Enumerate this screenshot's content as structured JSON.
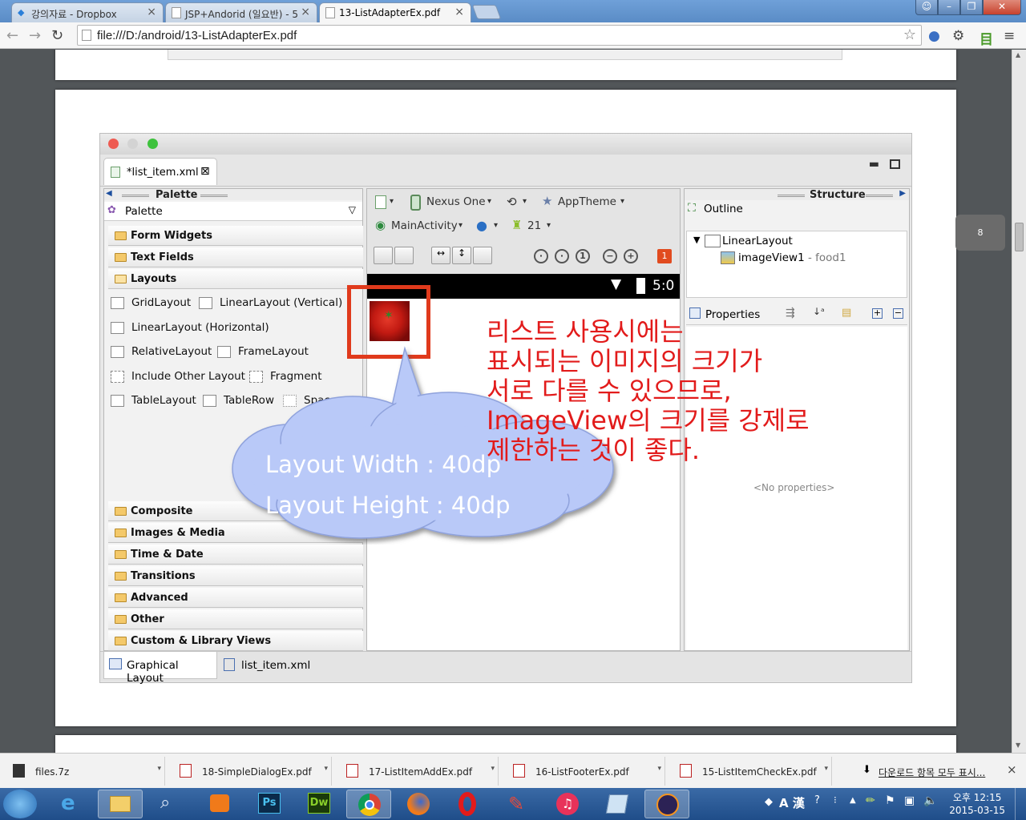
{
  "browser": {
    "tabs": [
      {
        "title": "강의자료 - Dropbox",
        "active": false
      },
      {
        "title": "JSP+Andorid (일요반) - 5",
        "active": false
      },
      {
        "title": "13-ListAdapterEx.pdf",
        "active": true
      }
    ],
    "url": "file:///D:/android/13-ListAdapterEx.pdf",
    "close_glyph": "×"
  },
  "pdf": {
    "page_number": "8",
    "callout_text": [
      "리스트 사용시에는",
      "표시되는 이미지의 크기가",
      "서로 다를 수 있으므로,",
      "ImageView의 크기를 강제로",
      "제한하는 것이 좋다."
    ],
    "cloud_text": [
      "Layout Width : 40dp",
      "Layout Height : 40dp"
    ]
  },
  "eclipse": {
    "editor_tab": "*list_item.xml",
    "palette": {
      "header": "Palette",
      "dropdown": "Palette",
      "categories_top": [
        "Form Widgets",
        "Text Fields",
        "Layouts"
      ],
      "layout_items": [
        "GridLayout",
        "LinearLayout (Vertical)",
        "LinearLayout (Horizontal)",
        "RelativeLayout",
        "FrameLayout",
        "Include Other Layout",
        "Fragment",
        "TableLayout",
        "TableRow",
        "Space"
      ],
      "categories_bottom": [
        "Composite",
        "Images & Media",
        "Time & Date",
        "Transitions",
        "Advanced",
        "Other",
        "Custom & Library Views"
      ]
    },
    "canvas": {
      "device": "Nexus One",
      "theme": "AppTheme",
      "activity": "MainActivity",
      "api": "21",
      "status_time": "5:0",
      "error_count": "1"
    },
    "structure": {
      "header": "Structure",
      "outline_label": "Outline",
      "tree": [
        {
          "label": "LinearLayout",
          "suffix": ""
        },
        {
          "label": "imageView1",
          "suffix": " - food1"
        }
      ],
      "properties_label": "Properties",
      "no_properties": "<No properties>"
    },
    "bottom_tabs": [
      "Graphical Layout",
      "list_item.xml"
    ]
  },
  "downloads": {
    "items": [
      "files.7z",
      "18-SimpleDialogEx.pdf",
      "17-ListItemAddEx.pdf",
      "16-ListFooterEx.pdf",
      "15-ListItemCheckEx.pdf"
    ],
    "show_all": "다운로드 항목 모두 표시...",
    "close": "×"
  },
  "taskbar": {
    "time": "오후 12:15",
    "date": "2015-03-15",
    "ime": "A 漢",
    "apps": [
      "start-orb",
      "ie",
      "explorer",
      "search-tool",
      "media-player",
      "photoshop",
      "dreamweaver",
      "chrome",
      "firefox",
      "opera",
      "paint-tool",
      "itunes",
      "notebook",
      "eclipse"
    ],
    "app_glyphs": {
      "photoshop": "Ps",
      "dreamweaver": "Dw"
    }
  },
  "colors": {
    "callout_red": "#e21b1b",
    "cloud_fill": "#b9c9f8",
    "highlight_red": "#e03a1c"
  }
}
